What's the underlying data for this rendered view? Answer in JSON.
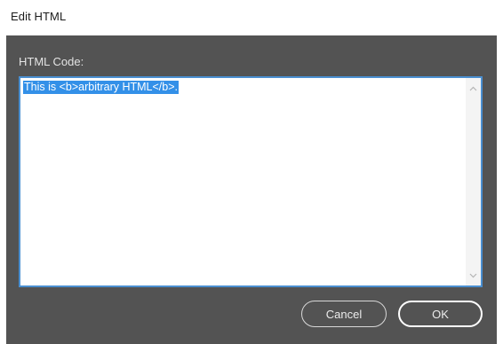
{
  "window": {
    "title": "Edit HTML"
  },
  "editor": {
    "label": "HTML Code:",
    "value": "This is <b>arbitrary HTML</b>."
  },
  "buttons": {
    "cancel": "Cancel",
    "ok": "OK"
  },
  "icons": {
    "scroll_up": "chevron-up-icon",
    "scroll_down": "chevron-down-icon"
  },
  "colors": {
    "dialog_body": "#535353",
    "selection": "#3390e8",
    "focus_border": "#4a8fd1"
  }
}
